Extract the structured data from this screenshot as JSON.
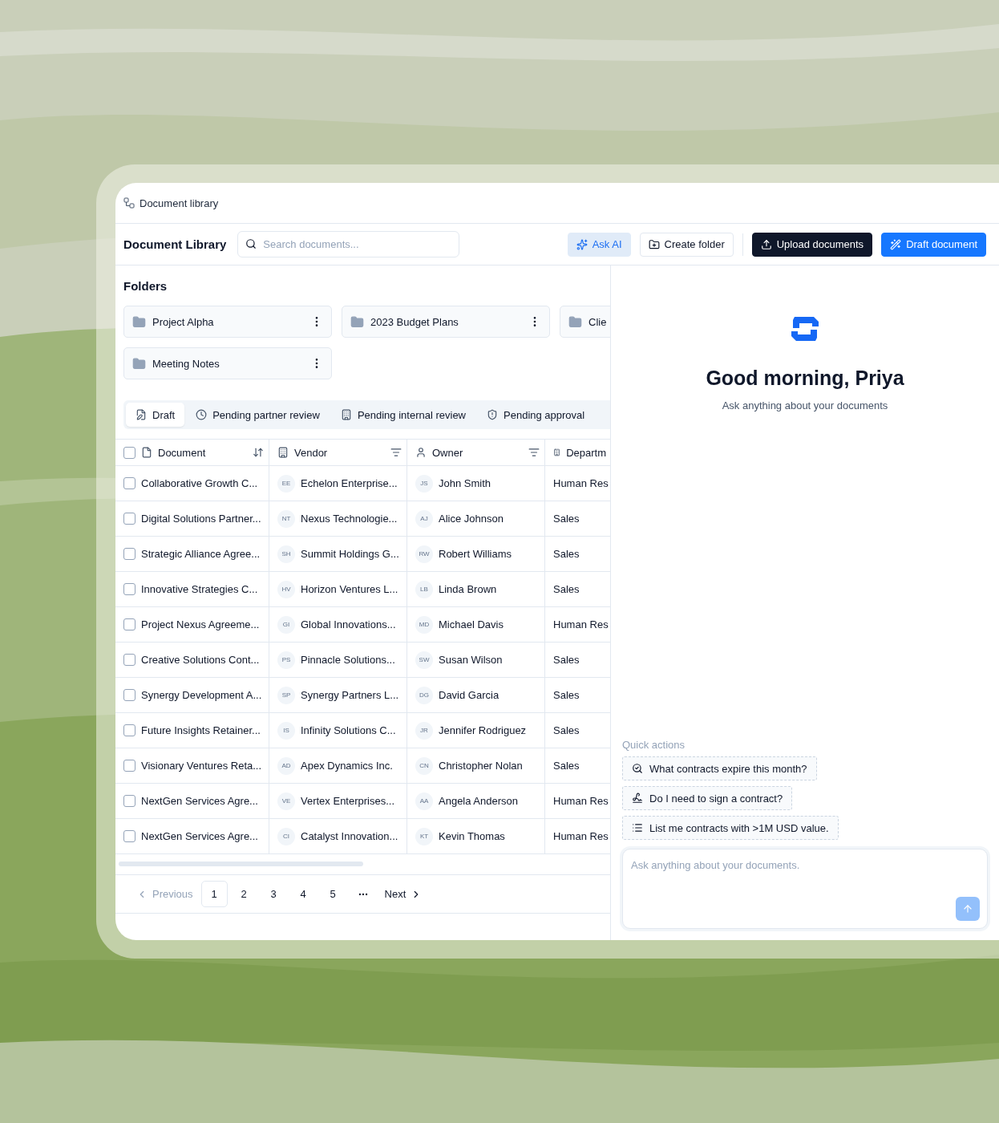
{
  "breadcrumb": "Document library",
  "toolbar": {
    "title": "Document Library",
    "search_placeholder": "Search documents...",
    "buttons": [
      {
        "label": "Ask AI",
        "kind": "soft"
      },
      {
        "label": "Create folder",
        "kind": "outline"
      },
      {
        "label": "Upload documents",
        "kind": "dark"
      },
      {
        "label": "Draft document",
        "kind": "primary"
      }
    ]
  },
  "folders_title": "Folders",
  "folders": [
    {
      "name": "Project Alpha"
    },
    {
      "name": "2023 Budget Plans"
    },
    {
      "name": "Clie"
    },
    {
      "name": "Meeting Notes"
    }
  ],
  "tabs": [
    {
      "label": "Draft",
      "selected": true
    },
    {
      "label": "Pending partner review",
      "selected": false
    },
    {
      "label": "Pending internal review",
      "selected": false
    },
    {
      "label": "Pending approval",
      "selected": false
    }
  ],
  "table": {
    "select_all": {
      "checked": false
    },
    "columns": [
      {
        "label": "Document",
        "kind": "sort"
      },
      {
        "label": "Vendor",
        "kind": "filter"
      },
      {
        "label": "Owner",
        "kind": "filter"
      },
      {
        "label": "Departm",
        "kind": "none"
      }
    ],
    "rows": [
      {
        "checked": false,
        "document": "Collaborative Growth C...",
        "vendor_initials": "EE",
        "vendor": "Echelon Enterprise...",
        "owner_initials": "JS",
        "owner": "John Smith",
        "department": "Human Res"
      },
      {
        "checked": false,
        "document": "Digital Solutions Partner...",
        "vendor_initials": "NT",
        "vendor": "Nexus Technologie...",
        "owner_initials": "AJ",
        "owner": "Alice Johnson",
        "department": "Sales"
      },
      {
        "checked": false,
        "document": "Strategic Alliance Agree...",
        "vendor_initials": "SH",
        "vendor": "Summit Holdings G...",
        "owner_initials": "RW",
        "owner": "Robert Williams",
        "department": "Sales"
      },
      {
        "checked": false,
        "document": "Innovative Strategies C...",
        "vendor_initials": "HV",
        "vendor": "Horizon Ventures L...",
        "owner_initials": "LB",
        "owner": "Linda Brown",
        "department": "Sales"
      },
      {
        "checked": false,
        "document": "Project Nexus Agreeme...",
        "vendor_initials": "GI",
        "vendor": "Global Innovations...",
        "owner_initials": "MD",
        "owner": "Michael Davis",
        "department": "Human Res"
      },
      {
        "checked": false,
        "document": "Creative Solutions Cont...",
        "vendor_initials": "PS",
        "vendor": "Pinnacle Solutions...",
        "owner_initials": "SW",
        "owner": "Susan Wilson",
        "department": "Sales"
      },
      {
        "checked": false,
        "document": "Synergy Development A...",
        "vendor_initials": "SP",
        "vendor": "Synergy Partners L...",
        "owner_initials": "DG",
        "owner": "David Garcia",
        "department": "Sales"
      },
      {
        "checked": false,
        "document": "Future Insights Retainer...",
        "vendor_initials": "IS",
        "vendor": "Infinity Solutions C...",
        "owner_initials": "JR",
        "owner": "Jennifer Rodriguez",
        "department": "Sales"
      },
      {
        "checked": false,
        "document": "Visionary Ventures Reta...",
        "vendor_initials": "AD",
        "vendor": "Apex Dynamics Inc.",
        "owner_initials": "CN",
        "owner": "Christopher Nolan",
        "department": "Sales"
      },
      {
        "checked": false,
        "document": "NextGen Services Agre...",
        "vendor_initials": "VE",
        "vendor": "Vertex Enterprises...",
        "owner_initials": "AA",
        "owner": "Angela Anderson",
        "department": "Human Res"
      },
      {
        "checked": false,
        "document": "NextGen Services Agre...",
        "vendor_initials": "CI",
        "vendor": "Catalyst Innovation...",
        "owner_initials": "KT",
        "owner": "Kevin Thomas",
        "department": "Human Res"
      }
    ]
  },
  "pagination": {
    "previous": "Previous",
    "pages": [
      {
        "label": "1",
        "selected": true
      },
      {
        "label": "2",
        "selected": false
      },
      {
        "label": "3",
        "selected": false
      },
      {
        "label": "4",
        "selected": false
      },
      {
        "label": "5",
        "selected": false
      }
    ],
    "next": "Next"
  },
  "assistant": {
    "greeting": "Good morning, Priya",
    "subtitle": "Ask anything about your documents",
    "quick_actions_label": "Quick actions",
    "quick_actions": [
      {
        "label": "What contracts expire this month?"
      },
      {
        "label": "Do I need to sign a contract?"
      },
      {
        "label": "List me contracts with >1M USD value."
      }
    ],
    "input_placeholder": "Ask anything about your documents."
  }
}
